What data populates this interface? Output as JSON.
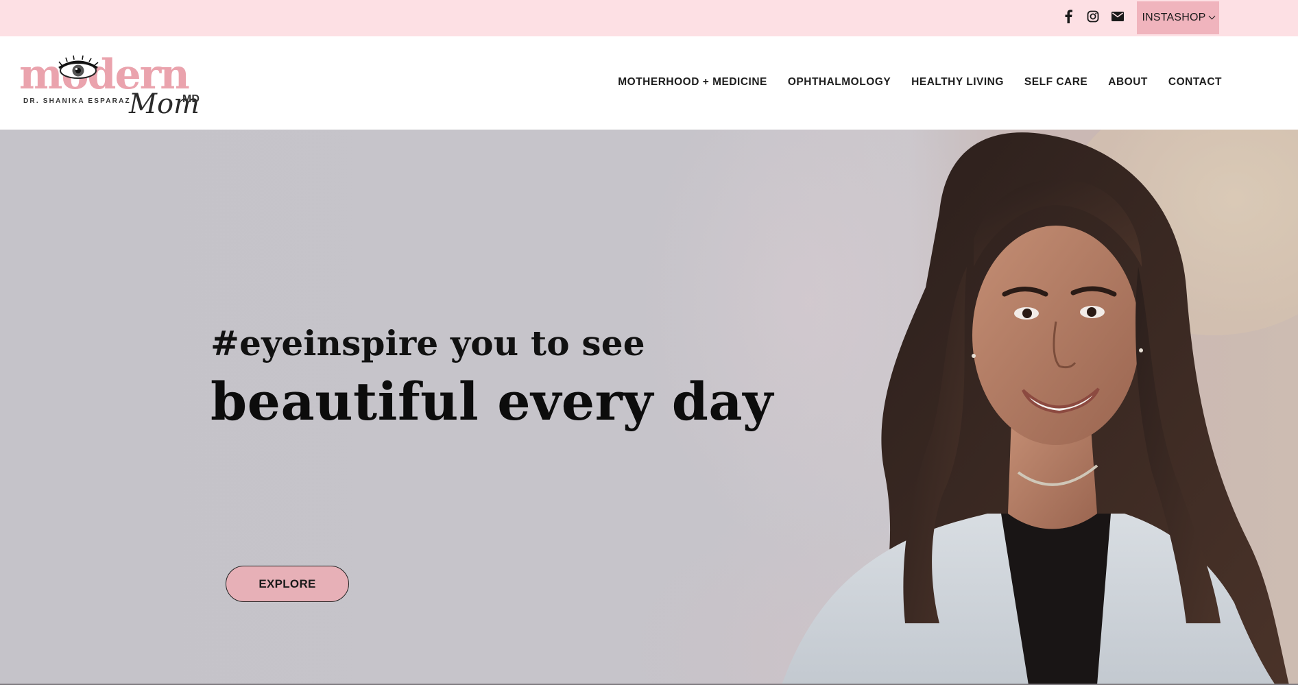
{
  "topbar": {
    "social_icons": [
      "facebook-icon",
      "instagram-icon",
      "email-icon"
    ],
    "instashop_label": "INSTASHOP",
    "background": "#fde0e4",
    "instashop_background": "#f0b4bd"
  },
  "logo": {
    "brand_word": "modern",
    "script_word": "Mom",
    "suffix": "MD",
    "tagline": "DR. SHANIKA ESPARAZ",
    "accent_color": "#eaa3ad"
  },
  "nav": {
    "items": [
      {
        "label": "MOTHERHOOD + MEDICINE"
      },
      {
        "label": "OPHTHALMOLOGY"
      },
      {
        "label": "HEALTHY LIVING"
      },
      {
        "label": "SELF CARE"
      },
      {
        "label": "ABOUT"
      },
      {
        "label": "CONTACT"
      }
    ]
  },
  "hero": {
    "line1": "#eyeinspire you to see",
    "line2": "beautiful every day",
    "cta_label": "EXPLORE",
    "cta_color": "#e7b0b7"
  }
}
